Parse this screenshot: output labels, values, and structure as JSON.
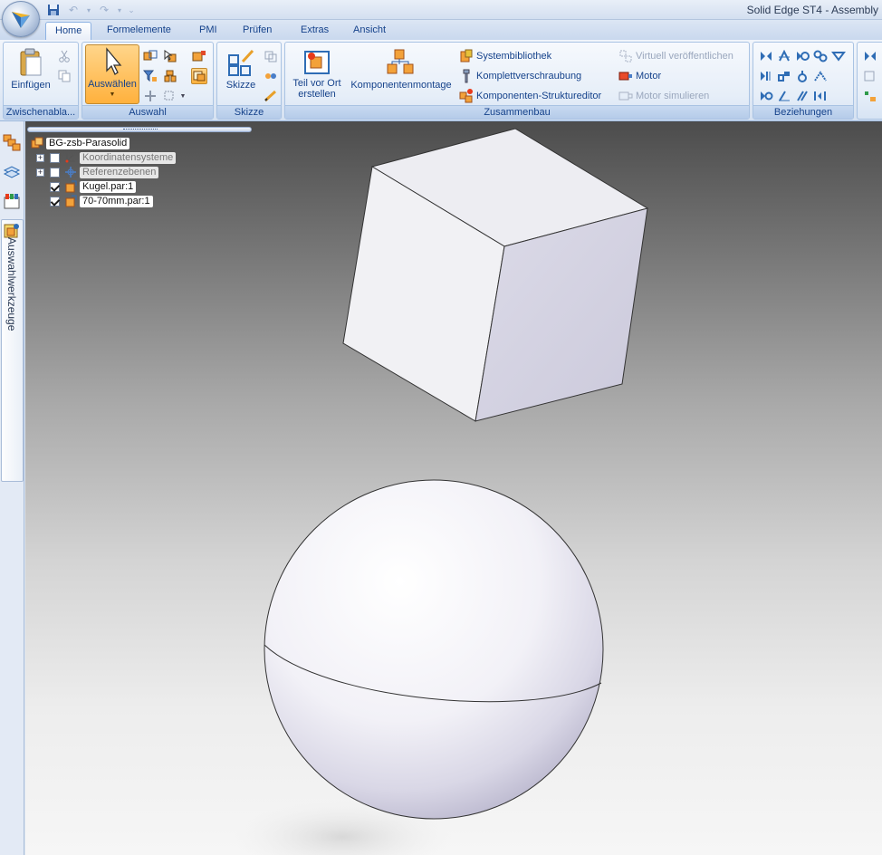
{
  "window": {
    "title": "Solid Edge ST4 - Assembly"
  },
  "quick_access": {
    "icons": [
      "save-icon",
      "undo-icon",
      "redo-icon",
      "customize-icon"
    ]
  },
  "tabs": [
    {
      "label": "Home",
      "active": true
    },
    {
      "label": "Formelemente"
    },
    {
      "label": "PMI"
    },
    {
      "label": "Prüfen"
    },
    {
      "label": "Extras"
    },
    {
      "label": "Ansicht"
    }
  ],
  "ribbon": {
    "clipboard": {
      "label": "Zwischenabla...",
      "paste": "Einfügen"
    },
    "select": {
      "label": "Auswahl",
      "select_button": "Auswählen"
    },
    "sketch": {
      "label": "Skizze",
      "sketch_button": "Skizze"
    },
    "assembly": {
      "label": "Zusammenbau",
      "create_in_place": "Teil vor Ort",
      "create_in_place_2": "erstellen",
      "components_assembly": "Komponentenmontage",
      "system_library": "Systembibliothek",
      "fastener": "Komplettverschraubung",
      "structure_editor": "Komponenten-Strukturedi­tor",
      "virtual_publish": "Virtuell veröffentlichen",
      "motor": "Motor",
      "simulate_motor": "Motor simulieren"
    },
    "relations": {
      "label": "Beziehungen"
    }
  },
  "side_panel": {
    "tab_label": "Auswahlwerkzeuge"
  },
  "tree": {
    "root": "BG-zsb-Parasolid",
    "items": [
      {
        "label": "Koordinatensysteme",
        "checked": false,
        "expandable": true
      },
      {
        "label": "Referenzebenen",
        "checked": false,
        "expandable": true
      },
      {
        "label": "Kugel.par:1",
        "checked": true,
        "expandable": false
      },
      {
        "label": "70-70mm.par:1",
        "checked": true,
        "expandable": false
      }
    ]
  },
  "colors": {
    "accent": "#15428b",
    "selected": "#ffb13d",
    "viewport_top": "#4c4c4c",
    "viewport_bottom": "#f6f6f6"
  }
}
